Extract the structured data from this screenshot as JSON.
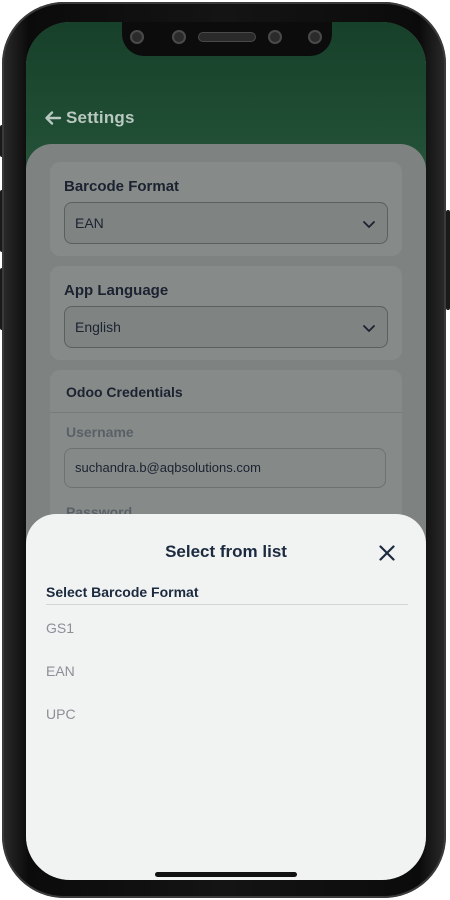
{
  "header": {
    "back_icon": "arrow-left-icon",
    "title": "Settings"
  },
  "barcode_format": {
    "label": "Barcode Format",
    "value": "EAN"
  },
  "app_language": {
    "label": "App Language",
    "value": "English"
  },
  "credentials": {
    "title": "Odoo Credentials",
    "username_label": "Username",
    "username_value": "suchandra.b@aqbsolutions.com",
    "password_label": "Password"
  },
  "sheet": {
    "title": "Select from list",
    "close_icon": "close-icon",
    "list_heading": "Select Barcode Format",
    "options": [
      "GS1",
      "EAN",
      "UPC"
    ]
  },
  "colors": {
    "header_green": "#1f4d33",
    "sheet_bg": "#f1f2f2",
    "title_navy": "#1b2a3f",
    "option_gray": "#8a9096"
  }
}
